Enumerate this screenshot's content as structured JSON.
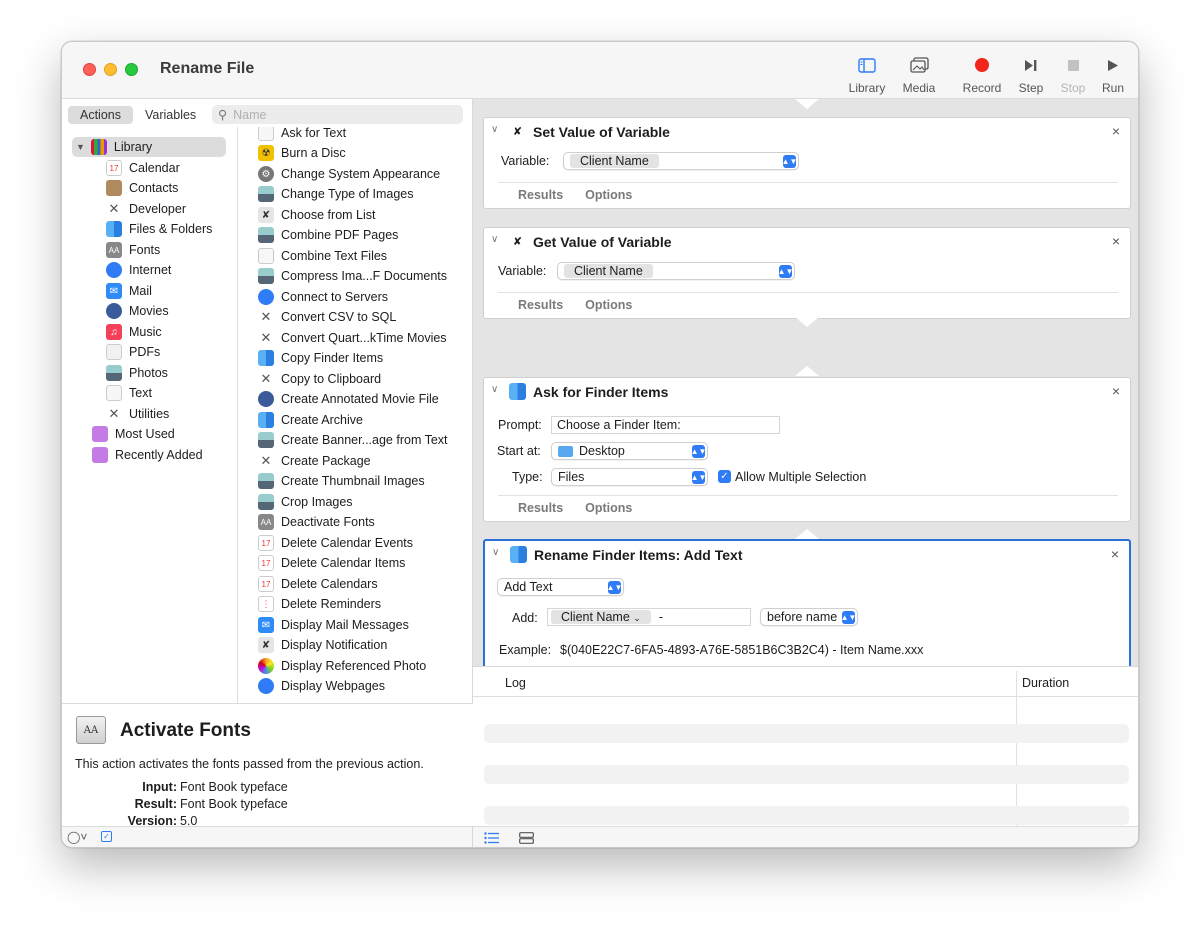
{
  "window": {
    "title": "Rename File"
  },
  "toolbar": {
    "library": "Library",
    "media": "Media",
    "record": "Record",
    "step": "Step",
    "stop": "Stop",
    "run": "Run"
  },
  "tabs": {
    "actions": "Actions",
    "variables": "Variables"
  },
  "search": {
    "placeholder": "Name"
  },
  "library": {
    "root": "Library",
    "items": [
      "Calendar",
      "Contacts",
      "Developer",
      "Files & Folders",
      "Fonts",
      "Internet",
      "Mail",
      "Movies",
      "Music",
      "PDFs",
      "Photos",
      "Text",
      "Utilities"
    ],
    "most_used": "Most Used",
    "recently_added": "Recently Added"
  },
  "actions": [
    "Ask for Text",
    "Burn a Disc",
    "Change System Appearance",
    "Change Type of Images",
    "Choose from List",
    "Combine PDF Pages",
    "Combine Text Files",
    "Compress Ima...F Documents",
    "Connect to Servers",
    "Convert CSV to SQL",
    "Convert Quart...kTime Movies",
    "Copy Finder Items",
    "Copy to Clipboard",
    "Create Annotated Movie File",
    "Create Archive",
    "Create Banner...age from Text",
    "Create Package",
    "Create Thumbnail Images",
    "Crop Images",
    "Deactivate Fonts",
    "Delete Calendar Events",
    "Delete Calendar Items",
    "Delete Calendars",
    "Delete Reminders",
    "Display Mail Messages",
    "Display Notification",
    "Display Referenced Photo",
    "Display Webpages"
  ],
  "description": {
    "icon_text": "AA",
    "title": "Activate Fonts",
    "text": "This action activates the fonts passed from the previous action.",
    "input_label": "Input:",
    "input": "Font Book typeface",
    "result_label": "Result:",
    "result": "Font Book typeface",
    "version_label": "Version:",
    "version": "5.0"
  },
  "workflow": {
    "results": "Results",
    "options": "Options",
    "set_var": {
      "title": "Set Value of Variable",
      "label": "Variable:",
      "value": "Client Name"
    },
    "get_var": {
      "title": "Get Value of Variable",
      "label": "Variable:",
      "value": "Client Name"
    },
    "ask_finder": {
      "title": "Ask for Finder Items",
      "prompt_label": "Prompt:",
      "prompt": "Choose a Finder Item:",
      "start_label": "Start at:",
      "start": "Desktop",
      "type_label": "Type:",
      "type": "Files",
      "allow_multi": "Allow Multiple Selection"
    },
    "rename": {
      "title": "Rename Finder Items: Add Text",
      "mode": "Add Text",
      "add_label": "Add:",
      "token": "Client Name",
      "text": "-",
      "position": "before name",
      "example_label": "Example:",
      "example": "$(040E22C7-6FA5-4893-A76E-5851B6C3B2C4) - Item Name.xxx"
    }
  },
  "log": {
    "col_log": "Log",
    "col_duration": "Duration"
  }
}
